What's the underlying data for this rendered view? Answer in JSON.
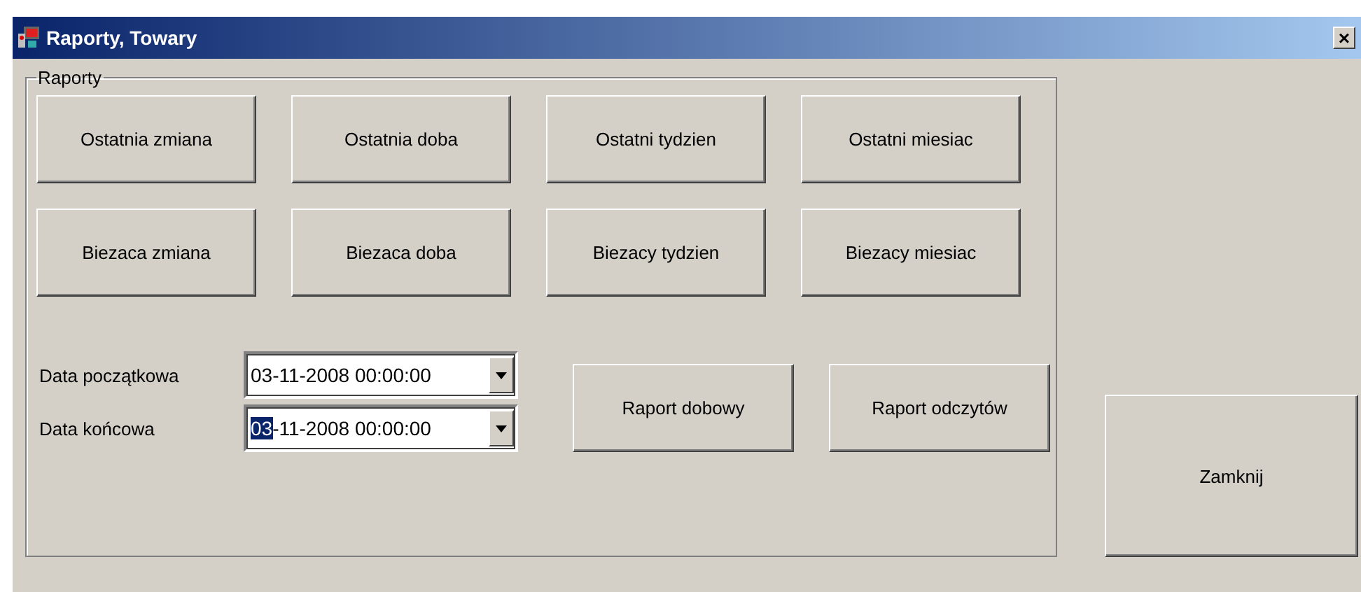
{
  "window": {
    "title": "Raporty, Towary",
    "close": "×"
  },
  "group": {
    "title": "Raporty",
    "period_buttons": [
      {
        "label": "Ostatnia zmiana"
      },
      {
        "label": "Ostatnia doba"
      },
      {
        "label": "Ostatni tydzien"
      },
      {
        "label": "Ostatni miesiac"
      },
      {
        "label": "Biezaca zmiana"
      },
      {
        "label": "Biezaca doba"
      },
      {
        "label": "Biezacy tydzien"
      },
      {
        "label": "Biezacy miesiac"
      }
    ],
    "date_fields": [
      {
        "label": "Data początkowa",
        "value_parts": [
          {
            "text": "03-11-2008 00:00:00",
            "selected": false
          }
        ]
      },
      {
        "label": "Data końcowa",
        "value_parts": [
          {
            "text": "03",
            "selected": true
          },
          {
            "text": "-11-2008 00:00:00",
            "selected": false
          }
        ]
      }
    ],
    "report_buttons": [
      {
        "label": "Raport dobowy"
      },
      {
        "label": "Raport odczytów"
      }
    ]
  },
  "close_button": {
    "label": "Zamknij"
  }
}
